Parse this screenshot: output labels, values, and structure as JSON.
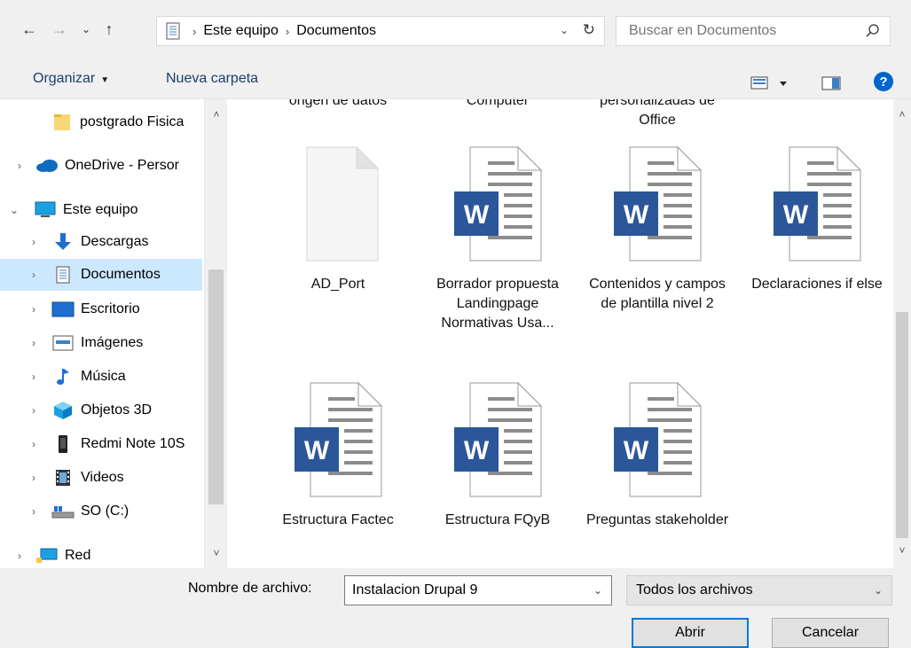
{
  "address": {
    "crumbs": [
      "Este equipo",
      "Documentos"
    ]
  },
  "search": {
    "placeholder": "Buscar en Documentos"
  },
  "toolbar": {
    "organize": "Organizar",
    "new_folder": "Nueva carpeta"
  },
  "sidebar": {
    "items": [
      {
        "label": "postgrado Fisica",
        "icon": "folder-icon"
      },
      {
        "label": "OneDrive - Persor",
        "icon": "cloud-icon"
      },
      {
        "label": "Este equipo",
        "icon": "computer-icon"
      },
      {
        "label": "Descargas",
        "icon": "download-icon"
      },
      {
        "label": "Documentos",
        "icon": "documents-icon"
      },
      {
        "label": "Escritorio",
        "icon": "desktop-icon"
      },
      {
        "label": "Imágenes",
        "icon": "pictures-icon"
      },
      {
        "label": "Música",
        "icon": "music-icon"
      },
      {
        "label": "Objetos 3D",
        "icon": "cube-icon"
      },
      {
        "label": "Redmi Note 10S",
        "icon": "phone-icon"
      },
      {
        "label": "Videos",
        "icon": "video-icon"
      },
      {
        "label": "SO (C:)",
        "icon": "drive-icon"
      },
      {
        "label": "Red",
        "icon": "network-icon"
      }
    ]
  },
  "files": {
    "partial_labels": [
      "origen de datos",
      "Computer",
      "personalizadas de"
    ],
    "partial_office": "Office",
    "items": [
      {
        "name": "AD_Port",
        "type": "blank"
      },
      {
        "name": "Borrador propuesta Landingpage Normativas Usa...",
        "type": "word"
      },
      {
        "name": "Contenidos y campos de plantilla nivel 2",
        "type": "word"
      },
      {
        "name": "Declaraciones if else",
        "type": "word"
      },
      {
        "name": "Estructura Factec",
        "type": "word"
      },
      {
        "name": "Estructura FQyB",
        "type": "word"
      },
      {
        "name": "Preguntas stakeholder",
        "type": "word"
      }
    ],
    "word_letter": "W"
  },
  "bottom": {
    "filename_label": "Nombre de archivo:",
    "filename_value": "Instalacion Drupal 9",
    "filetype": "Todos los archivos",
    "open": "Abrir",
    "cancel": "Cancelar"
  },
  "colors": {
    "selection": "#cce8ff",
    "word_blue": "#2b579a",
    "help_blue": "#0066cc",
    "primary_border": "#0078d7"
  }
}
